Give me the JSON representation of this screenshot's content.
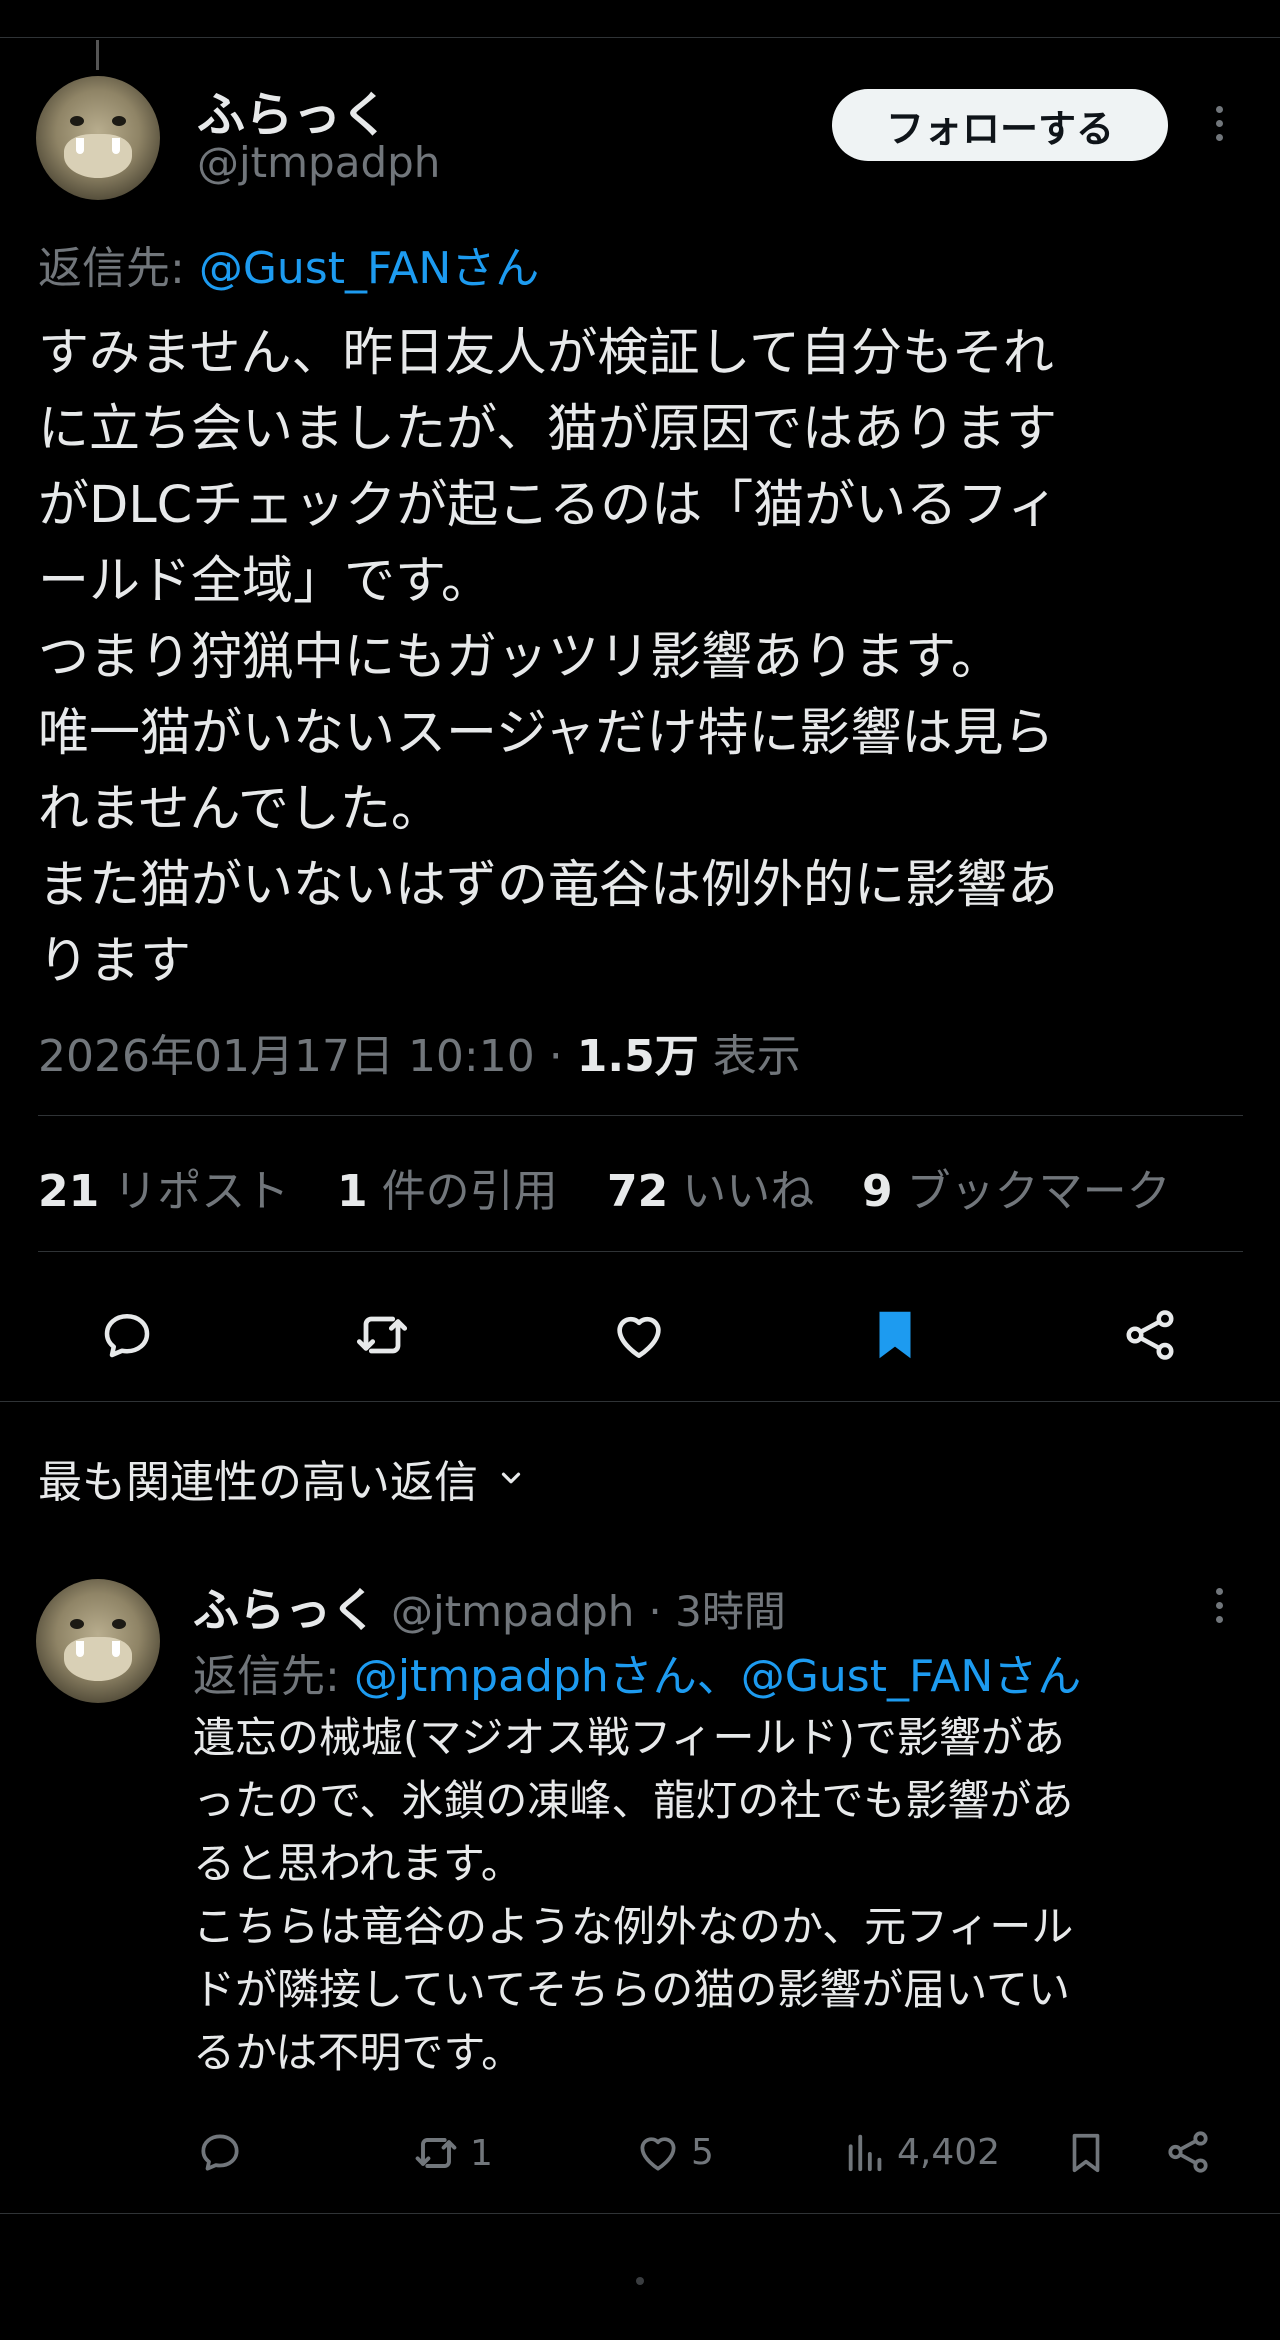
{
  "tweet": {
    "display_name": "ふらっく",
    "handle": "@jtmpadph",
    "follow_label": "フォローする",
    "reply_to_prefix": "返信先:",
    "reply_to": "@Gust_FANさん",
    "body": "すみません、昨日友人が検証して自分もそれ\nに立ち会いましたが、猫が原因ではあります\nがDLCチェックが起こるのは「猫がいるフィ\nールド全域」です。\nつまり狩猟中にもガッツリ影響あります。\n唯一猫がいないスージャだけ特に影響は見ら\nれませんでした。\nまた猫がいないはずの竜谷は例外的に影響あ\nります",
    "timestamp": "2026年01月17日 10:10",
    "separator": "·",
    "views": "1.5万",
    "views_label": "表示",
    "stats": {
      "reposts_count": "21",
      "reposts_label": "リポスト",
      "quotes_count": "1",
      "quotes_label": "件の引用",
      "likes_count": "72",
      "likes_label": "いいね",
      "bookmarks_count": "9",
      "bookmarks_label": "ブックマーク"
    }
  },
  "replies_header": {
    "label": "最も関連性の高い返信"
  },
  "reply": {
    "display_name": "ふらっく",
    "handle": "@jtmpadph",
    "time": "· 3時間",
    "reply_to_prefix": "返信先:",
    "reply_to": "@jtmpadphさん、@Gust_FANさん",
    "body": "遺忘の械墟(マジオス戦フィールド)で影響があ\nったので、氷鎖の凍峰、龍灯の社でも影響があ\nると思われます。\nこちらは竜谷のような例外なのか、元フィール\nドが隣接していてそちらの猫の影響が届いてい\nるかは不明です。",
    "retweets": "1",
    "likes": "5",
    "views": "4,402"
  },
  "colors": {
    "background": "#000000",
    "text": "#e7e9ea",
    "muted": "#71767b",
    "accent": "#1d9bf0",
    "divider": "#2f3336"
  },
  "icons": [
    "reply-icon",
    "retweet-icon",
    "like-icon",
    "bookmark-icon",
    "share-icon",
    "views-icon",
    "more-icon",
    "chevron-down-icon"
  ]
}
